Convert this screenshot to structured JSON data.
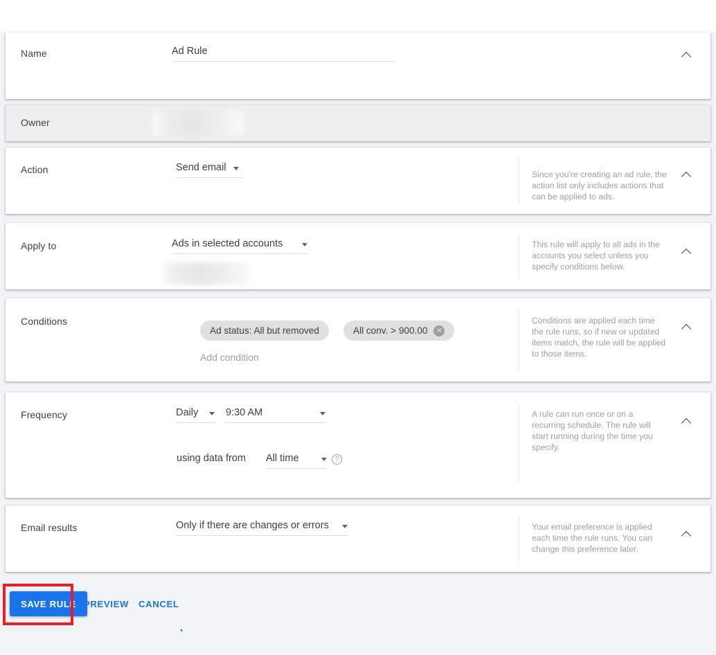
{
  "colors": {
    "accent": "#1a73e8",
    "highlight": "#ee1c25",
    "chip_bg": "#e0e0e0",
    "helper_text": "#9aa0a6",
    "page_bg": "#f1f3f4",
    "owner_row_bg": "#eeeeee"
  },
  "sections": {
    "name": {
      "label": "Name",
      "value": "Ad Rule",
      "collapse_icon": "chevron-up-icon"
    },
    "owner": {
      "label": "Owner",
      "value": "",
      "redacted": true
    },
    "action": {
      "label": "Action",
      "value": "Send email",
      "dropdown_icon": "caret-down-icon",
      "helper": "Since you're creating an ad rule, the action list only includes actions that can be applied to ads.",
      "collapse_icon": "chevron-up-icon"
    },
    "apply_to": {
      "label": "Apply to",
      "value": "Ads in selected accounts",
      "dropdown_icon": "caret-down-icon",
      "account_value": "",
      "helper": "This rule will apply to all ads in the accounts you select unless you specify conditions below.",
      "collapse_icon": "chevron-up-icon"
    },
    "conditions": {
      "label": "Conditions",
      "filter_icon": "filter-icon",
      "chips": [
        {
          "label": "Ad status: All but removed",
          "removable": false
        },
        {
          "label": "All conv. > 900.00",
          "removable": true,
          "remove_icon": "close-circle-icon"
        }
      ],
      "add_link": "Add condition",
      "helper": "Conditions are applied each time the rule runs, so if new or updated items match, the rule will be applied to those items.",
      "collapse_icon": "chevron-up-icon"
    },
    "frequency": {
      "label": "Frequency",
      "interval": "Daily",
      "time": "9:30 AM",
      "data_from_label": "using data from",
      "data_range": "All time",
      "help_icon": "help-circle-icon",
      "helper": "A rule can run once or on a recurring schedule. The rule will start running during the time you specify.",
      "collapse_icon": "chevron-up-icon"
    },
    "email_results": {
      "label": "Email results",
      "value": "Only if there are changes or errors",
      "dropdown_icon": "caret-down-icon",
      "helper": "Your email preference is applied each time the rule runs. You can change this preference later.",
      "collapse_icon": "chevron-up-icon"
    }
  },
  "footer": {
    "save_label": "SAVE RULE",
    "preview_label": "PREVIEW",
    "cancel_label": "CANCEL"
  }
}
